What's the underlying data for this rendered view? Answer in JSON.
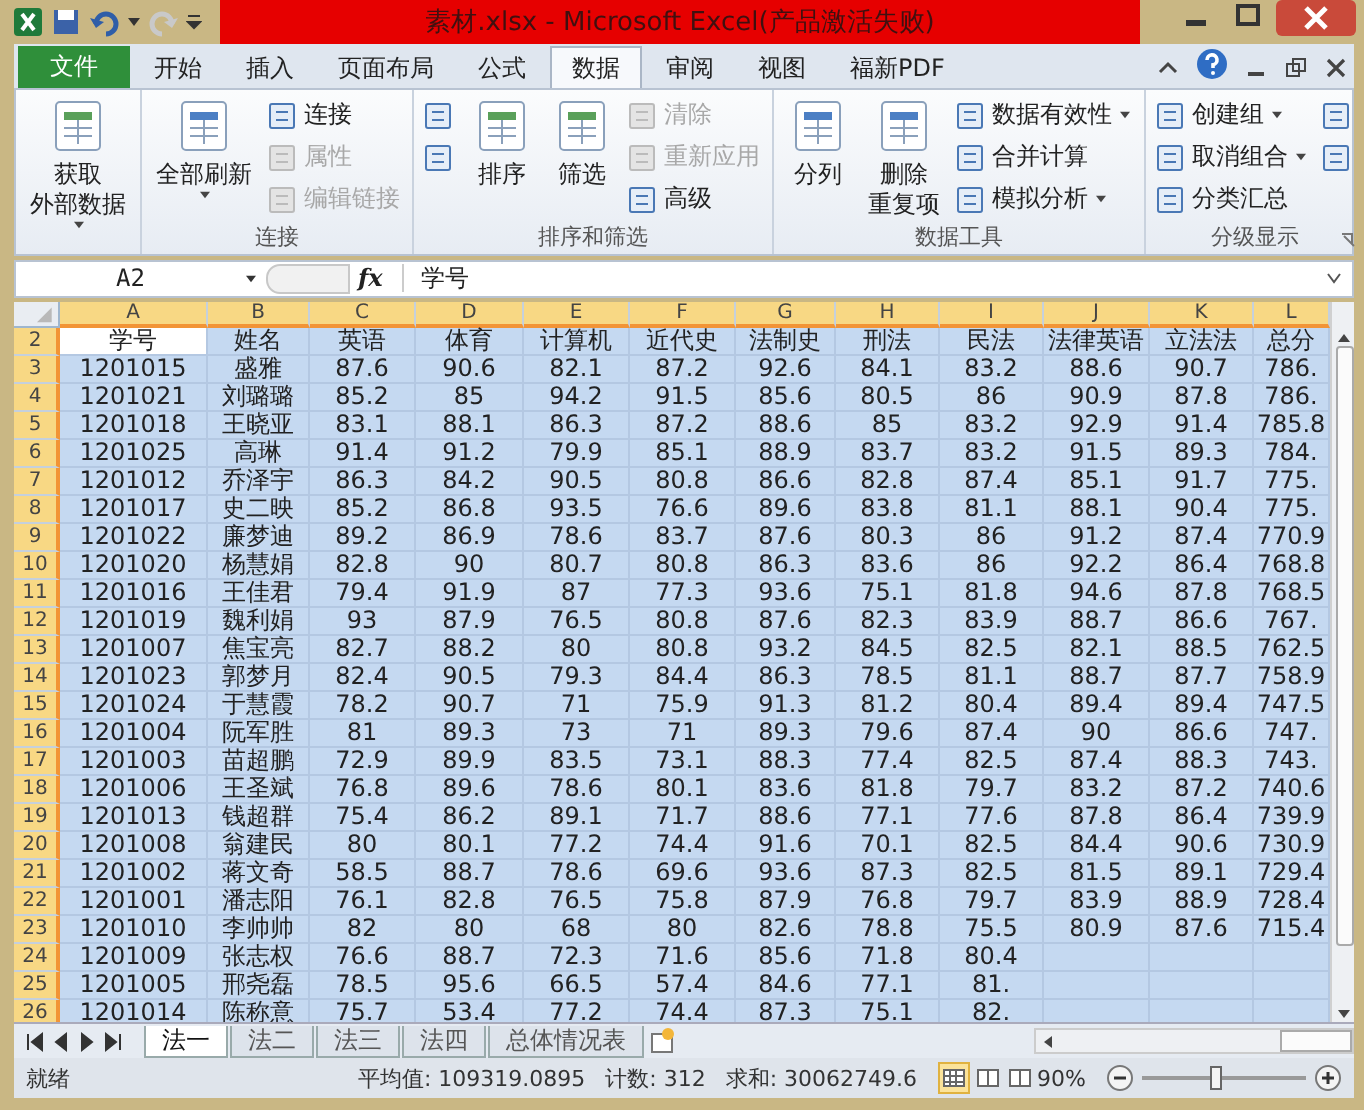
{
  "window": {
    "title": "素材.xlsx - Microsoft Excel(产品激活失败)"
  },
  "tabs": [
    {
      "label": "文件",
      "kind": "file",
      "selected": false
    },
    {
      "label": "开始",
      "kind": "tab",
      "selected": false
    },
    {
      "label": "插入",
      "kind": "tab",
      "selected": false
    },
    {
      "label": "页面布局",
      "kind": "tab",
      "selected": false
    },
    {
      "label": "公式",
      "kind": "tab",
      "selected": false
    },
    {
      "label": "数据",
      "kind": "tab",
      "selected": true
    },
    {
      "label": "审阅",
      "kind": "tab",
      "selected": false
    },
    {
      "label": "视图",
      "kind": "tab",
      "selected": false
    },
    {
      "label": "福新PDF",
      "kind": "tab",
      "selected": false
    }
  ],
  "ribbon": {
    "groups": [
      {
        "columns": [
          {
            "kind": "large",
            "lines": [
              "获取",
              "外部数据"
            ],
            "dropdown": true,
            "disabled": false
          }
        ]
      },
      {
        "label": "连接",
        "columns": [
          {
            "kind": "large",
            "lines": [
              "全部刷新"
            ],
            "dropdown": true,
            "disabled": false
          },
          {
            "kind": "stack",
            "items": [
              {
                "label": "连接",
                "disabled": false
              },
              {
                "label": "属性",
                "disabled": true
              },
              {
                "label": "编辑链接",
                "disabled": true
              }
            ]
          }
        ]
      },
      {
        "label": "排序和筛选",
        "columns": [
          {
            "kind": "stack",
            "items": [
              {
                "disabled": false
              },
              {
                "disabled": false
              }
            ]
          },
          {
            "kind": "large",
            "lines": [
              "排序"
            ],
            "dropdown": false,
            "disabled": false
          },
          {
            "kind": "large",
            "lines": [
              "筛选"
            ],
            "dropdown": false,
            "disabled": false
          },
          {
            "kind": "stack",
            "items": [
              {
                "label": "清除",
                "disabled": true
              },
              {
                "label": "重新应用",
                "disabled": true
              },
              {
                "label": "高级",
                "disabled": false
              }
            ]
          }
        ]
      },
      {
        "label": "数据工具",
        "columns": [
          {
            "kind": "large",
            "lines": [
              "分列"
            ],
            "dropdown": false,
            "disabled": false
          },
          {
            "kind": "large",
            "lines": [
              "删除",
              "重复项"
            ],
            "dropdown": false,
            "disabled": false
          },
          {
            "kind": "stack",
            "items": [
              {
                "label": "数据有效性",
                "dropdown": true,
                "disabled": false
              },
              {
                "label": "合并计算",
                "disabled": false
              },
              {
                "label": "模拟分析",
                "dropdown": true,
                "disabled": false
              }
            ]
          }
        ]
      },
      {
        "label": "分级显示",
        "launcher": true,
        "columns": [
          {
            "kind": "stack",
            "items": [
              {
                "label": "创建组",
                "dropdown": true,
                "disabled": false
              },
              {
                "label": "取消组合",
                "dropdown": true,
                "disabled": false
              },
              {
                "label": "分类汇总",
                "disabled": false
              }
            ]
          },
          {
            "kind": "stack",
            "items": [
              {
                "disabled": false
              },
              {
                "disabled": false
              }
            ]
          }
        ]
      }
    ]
  },
  "formula_bar": {
    "name_box": "A2",
    "fx": "fx",
    "formula": "学号"
  },
  "columns": [
    {
      "letter": "A",
      "selected": true
    },
    {
      "letter": "B",
      "selected": true
    },
    {
      "letter": "C",
      "selected": true
    },
    {
      "letter": "D",
      "selected": true
    },
    {
      "letter": "E",
      "selected": true
    },
    {
      "letter": "F",
      "selected": true
    },
    {
      "letter": "G",
      "selected": true
    },
    {
      "letter": "H",
      "selected": true
    },
    {
      "letter": "I",
      "selected": true
    },
    {
      "letter": "J",
      "selected": true
    },
    {
      "letter": "K",
      "selected": true
    },
    {
      "letter": "L",
      "selected": true
    }
  ],
  "rows": [
    {
      "num": "2",
      "selected": true,
      "active": true,
      "cells": [
        "学号",
        "姓名",
        "英语",
        "体育",
        "计算机",
        "近代史",
        "法制史",
        "刑法",
        "民法",
        "法律英语",
        "立法法",
        "总分"
      ]
    },
    {
      "num": "3",
      "selected": true,
      "cells": [
        "1201015",
        "盛雅",
        "87.6",
        "90.6",
        "82.1",
        "87.2",
        "92.6",
        "84.1",
        "83.2",
        "88.6",
        "90.7",
        "786."
      ]
    },
    {
      "num": "4",
      "selected": true,
      "cells": [
        "1201021",
        "刘璐璐",
        "85.2",
        "85",
        "94.2",
        "91.5",
        "85.6",
        "80.5",
        "86",
        "90.9",
        "87.8",
        "786."
      ]
    },
    {
      "num": "5",
      "selected": true,
      "cells": [
        "1201018",
        "王晓亚",
        "83.1",
        "88.1",
        "86.3",
        "87.2",
        "88.6",
        "85",
        "83.2",
        "92.9",
        "91.4",
        "785.8"
      ]
    },
    {
      "num": "6",
      "selected": true,
      "cells": [
        "1201025",
        "高琳",
        "91.4",
        "91.2",
        "79.9",
        "85.1",
        "88.9",
        "83.7",
        "83.2",
        "91.5",
        "89.3",
        "784."
      ]
    },
    {
      "num": "7",
      "selected": true,
      "cells": [
        "1201012",
        "乔泽宇",
        "86.3",
        "84.2",
        "90.5",
        "80.8",
        "86.6",
        "82.8",
        "87.4",
        "85.1",
        "91.7",
        "775."
      ]
    },
    {
      "num": "8",
      "selected": true,
      "cells": [
        "1201017",
        "史二映",
        "85.2",
        "86.8",
        "93.5",
        "76.6",
        "89.6",
        "83.8",
        "81.1",
        "88.1",
        "90.4",
        "775."
      ]
    },
    {
      "num": "9",
      "selected": true,
      "cells": [
        "1201022",
        "廉梦迪",
        "89.2",
        "86.9",
        "78.6",
        "83.7",
        "87.6",
        "80.3",
        "86",
        "91.2",
        "87.4",
        "770.9"
      ]
    },
    {
      "num": "10",
      "selected": true,
      "cells": [
        "1201020",
        "杨慧娟",
        "82.8",
        "90",
        "80.7",
        "80.8",
        "86.3",
        "83.6",
        "86",
        "92.2",
        "86.4",
        "768.8"
      ]
    },
    {
      "num": "11",
      "selected": true,
      "cells": [
        "1201016",
        "王佳君",
        "79.4",
        "91.9",
        "87",
        "77.3",
        "93.6",
        "75.1",
        "81.8",
        "94.6",
        "87.8",
        "768.5"
      ]
    },
    {
      "num": "12",
      "selected": true,
      "cells": [
        "1201019",
        "魏利娟",
        "93",
        "87.9",
        "76.5",
        "80.8",
        "87.6",
        "82.3",
        "83.9",
        "88.7",
        "86.6",
        "767."
      ]
    },
    {
      "num": "13",
      "selected": true,
      "cells": [
        "1201007",
        "焦宝亮",
        "82.7",
        "88.2",
        "80",
        "80.8",
        "93.2",
        "84.5",
        "82.5",
        "82.1",
        "88.5",
        "762.5"
      ]
    },
    {
      "num": "14",
      "selected": true,
      "cells": [
        "1201023",
        "郭梦月",
        "82.4",
        "90.5",
        "79.3",
        "84.4",
        "86.3",
        "78.5",
        "81.1",
        "88.7",
        "87.7",
        "758.9"
      ]
    },
    {
      "num": "15",
      "selected": true,
      "cells": [
        "1201024",
        "于慧霞",
        "78.2",
        "90.7",
        "71",
        "75.9",
        "91.3",
        "81.2",
        "80.4",
        "89.4",
        "89.4",
        "747.5"
      ]
    },
    {
      "num": "16",
      "selected": true,
      "cells": [
        "1201004",
        "阮军胜",
        "81",
        "89.3",
        "73",
        "71",
        "89.3",
        "79.6",
        "87.4",
        "90",
        "86.6",
        "747."
      ]
    },
    {
      "num": "17",
      "selected": true,
      "cells": [
        "1201003",
        "苗超鹏",
        "72.9",
        "89.9",
        "83.5",
        "73.1",
        "88.3",
        "77.4",
        "82.5",
        "87.4",
        "88.3",
        "743."
      ]
    },
    {
      "num": "18",
      "selected": true,
      "cells": [
        "1201006",
        "王圣斌",
        "76.8",
        "89.6",
        "78.6",
        "80.1",
        "83.6",
        "81.8",
        "79.7",
        "83.2",
        "87.2",
        "740.6"
      ]
    },
    {
      "num": "19",
      "selected": true,
      "cells": [
        "1201013",
        "钱超群",
        "75.4",
        "86.2",
        "89.1",
        "71.7",
        "88.6",
        "77.1",
        "77.6",
        "87.8",
        "86.4",
        "739.9"
      ]
    },
    {
      "num": "20",
      "selected": true,
      "cells": [
        "1201008",
        "翁建民",
        "80",
        "80.1",
        "77.2",
        "74.4",
        "91.6",
        "70.1",
        "82.5",
        "84.4",
        "90.6",
        "730.9"
      ]
    },
    {
      "num": "21",
      "selected": true,
      "cells": [
        "1201002",
        "蒋文奇",
        "58.5",
        "88.7",
        "78.6",
        "69.6",
        "93.6",
        "87.3",
        "82.5",
        "81.5",
        "89.1",
        "729.4"
      ]
    },
    {
      "num": "22",
      "selected": true,
      "cells": [
        "1201001",
        "潘志阳",
        "76.1",
        "82.8",
        "76.5",
        "75.8",
        "87.9",
        "76.8",
        "79.7",
        "83.9",
        "88.9",
        "728.4"
      ]
    },
    {
      "num": "23",
      "selected": true,
      "cells": [
        "1201010",
        "李帅帅",
        "82",
        "80",
        "68",
        "80",
        "82.6",
        "78.8",
        "75.5",
        "80.9",
        "87.6",
        "715.4"
      ]
    },
    {
      "num": "24",
      "selected": true,
      "cells": [
        "1201009",
        "张志权",
        "76.6",
        "88.7",
        "72.3",
        "71.6",
        "85.6",
        "71.8",
        "80.4",
        null,
        null,
        null
      ]
    },
    {
      "num": "25",
      "selected": true,
      "cells": [
        "1201005",
        "邢尧磊",
        "78.5",
        "95.6",
        "66.5",
        "57.4",
        "84.6",
        "77.1",
        "81.",
        null,
        null,
        null
      ]
    },
    {
      "num": "26",
      "selected": true,
      "cells": [
        "1201014",
        "陈称意",
        "75.7",
        "53.4",
        "77.2",
        "74.4",
        "87.3",
        "75.1",
        "82.",
        null,
        null,
        null
      ]
    }
  ],
  "sheet_tabs": [
    {
      "label": "法一",
      "selected": true
    },
    {
      "label": "法二",
      "selected": false
    },
    {
      "label": "法三",
      "selected": false
    },
    {
      "label": "法四",
      "selected": false
    },
    {
      "label": "总体情况表",
      "selected": false
    }
  ],
  "status_bar": {
    "state": "就绪",
    "average": "平均值: 109319.0895",
    "count": "计数: 312",
    "sum": "求和: 30062749.6",
    "views": [
      {
        "selected": true
      },
      {
        "selected": false
      },
      {
        "selected": false
      }
    ],
    "zoom": "90%",
    "zoom_slider": {
      "level": 0.45
    }
  }
}
